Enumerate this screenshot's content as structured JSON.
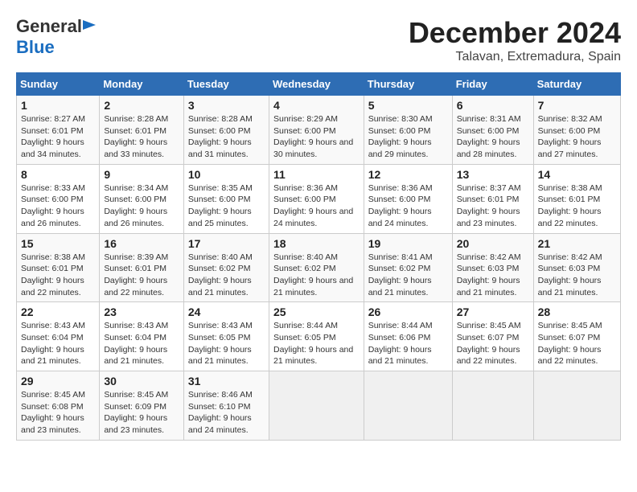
{
  "header": {
    "logo_general": "General",
    "logo_blue": "Blue",
    "month_title": "December 2024",
    "subtitle": "Talavan, Extremadura, Spain"
  },
  "calendar": {
    "days_of_week": [
      "Sunday",
      "Monday",
      "Tuesday",
      "Wednesday",
      "Thursday",
      "Friday",
      "Saturday"
    ],
    "weeks": [
      [
        null,
        null,
        null,
        null,
        null,
        null,
        null
      ]
    ],
    "cells": [
      {
        "day": null,
        "sunrise": null,
        "sunset": null,
        "daylight": null
      },
      {
        "day": null,
        "sunrise": null,
        "sunset": null,
        "daylight": null
      },
      {
        "day": null,
        "sunrise": null,
        "sunset": null,
        "daylight": null
      },
      {
        "day": null,
        "sunrise": null,
        "sunset": null,
        "daylight": null
      },
      {
        "day": null,
        "sunrise": null,
        "sunset": null,
        "daylight": null
      },
      {
        "day": null,
        "sunrise": null,
        "sunset": null,
        "daylight": null
      },
      {
        "day": null,
        "sunrise": null,
        "sunset": null,
        "daylight": null
      }
    ],
    "rows": [
      {
        "cells": [
          {
            "day": "1",
            "sunrise": "Sunrise: 8:27 AM",
            "sunset": "Sunset: 6:01 PM",
            "daylight": "Daylight: 9 hours and 34 minutes."
          },
          {
            "day": "2",
            "sunrise": "Sunrise: 8:28 AM",
            "sunset": "Sunset: 6:01 PM",
            "daylight": "Daylight: 9 hours and 33 minutes."
          },
          {
            "day": "3",
            "sunrise": "Sunrise: 8:28 AM",
            "sunset": "Sunset: 6:00 PM",
            "daylight": "Daylight: 9 hours and 31 minutes."
          },
          {
            "day": "4",
            "sunrise": "Sunrise: 8:29 AM",
            "sunset": "Sunset: 6:00 PM",
            "daylight": "Daylight: 9 hours and 30 minutes."
          },
          {
            "day": "5",
            "sunrise": "Sunrise: 8:30 AM",
            "sunset": "Sunset: 6:00 PM",
            "daylight": "Daylight: 9 hours and 29 minutes."
          },
          {
            "day": "6",
            "sunrise": "Sunrise: 8:31 AM",
            "sunset": "Sunset: 6:00 PM",
            "daylight": "Daylight: 9 hours and 28 minutes."
          },
          {
            "day": "7",
            "sunrise": "Sunrise: 8:32 AM",
            "sunset": "Sunset: 6:00 PM",
            "daylight": "Daylight: 9 hours and 27 minutes."
          }
        ]
      },
      {
        "cells": [
          {
            "day": "8",
            "sunrise": "Sunrise: 8:33 AM",
            "sunset": "Sunset: 6:00 PM",
            "daylight": "Daylight: 9 hours and 26 minutes."
          },
          {
            "day": "9",
            "sunrise": "Sunrise: 8:34 AM",
            "sunset": "Sunset: 6:00 PM",
            "daylight": "Daylight: 9 hours and 26 minutes."
          },
          {
            "day": "10",
            "sunrise": "Sunrise: 8:35 AM",
            "sunset": "Sunset: 6:00 PM",
            "daylight": "Daylight: 9 hours and 25 minutes."
          },
          {
            "day": "11",
            "sunrise": "Sunrise: 8:36 AM",
            "sunset": "Sunset: 6:00 PM",
            "daylight": "Daylight: 9 hours and 24 minutes."
          },
          {
            "day": "12",
            "sunrise": "Sunrise: 8:36 AM",
            "sunset": "Sunset: 6:00 PM",
            "daylight": "Daylight: 9 hours and 24 minutes."
          },
          {
            "day": "13",
            "sunrise": "Sunrise: 8:37 AM",
            "sunset": "Sunset: 6:01 PM",
            "daylight": "Daylight: 9 hours and 23 minutes."
          },
          {
            "day": "14",
            "sunrise": "Sunrise: 8:38 AM",
            "sunset": "Sunset: 6:01 PM",
            "daylight": "Daylight: 9 hours and 22 minutes."
          }
        ]
      },
      {
        "cells": [
          {
            "day": "15",
            "sunrise": "Sunrise: 8:38 AM",
            "sunset": "Sunset: 6:01 PM",
            "daylight": "Daylight: 9 hours and 22 minutes."
          },
          {
            "day": "16",
            "sunrise": "Sunrise: 8:39 AM",
            "sunset": "Sunset: 6:01 PM",
            "daylight": "Daylight: 9 hours and 22 minutes."
          },
          {
            "day": "17",
            "sunrise": "Sunrise: 8:40 AM",
            "sunset": "Sunset: 6:02 PM",
            "daylight": "Daylight: 9 hours and 21 minutes."
          },
          {
            "day": "18",
            "sunrise": "Sunrise: 8:40 AM",
            "sunset": "Sunset: 6:02 PM",
            "daylight": "Daylight: 9 hours and 21 minutes."
          },
          {
            "day": "19",
            "sunrise": "Sunrise: 8:41 AM",
            "sunset": "Sunset: 6:02 PM",
            "daylight": "Daylight: 9 hours and 21 minutes."
          },
          {
            "day": "20",
            "sunrise": "Sunrise: 8:42 AM",
            "sunset": "Sunset: 6:03 PM",
            "daylight": "Daylight: 9 hours and 21 minutes."
          },
          {
            "day": "21",
            "sunrise": "Sunrise: 8:42 AM",
            "sunset": "Sunset: 6:03 PM",
            "daylight": "Daylight: 9 hours and 21 minutes."
          }
        ]
      },
      {
        "cells": [
          {
            "day": "22",
            "sunrise": "Sunrise: 8:43 AM",
            "sunset": "Sunset: 6:04 PM",
            "daylight": "Daylight: 9 hours and 21 minutes."
          },
          {
            "day": "23",
            "sunrise": "Sunrise: 8:43 AM",
            "sunset": "Sunset: 6:04 PM",
            "daylight": "Daylight: 9 hours and 21 minutes."
          },
          {
            "day": "24",
            "sunrise": "Sunrise: 8:43 AM",
            "sunset": "Sunset: 6:05 PM",
            "daylight": "Daylight: 9 hours and 21 minutes."
          },
          {
            "day": "25",
            "sunrise": "Sunrise: 8:44 AM",
            "sunset": "Sunset: 6:05 PM",
            "daylight": "Daylight: 9 hours and 21 minutes."
          },
          {
            "day": "26",
            "sunrise": "Sunrise: 8:44 AM",
            "sunset": "Sunset: 6:06 PM",
            "daylight": "Daylight: 9 hours and 21 minutes."
          },
          {
            "day": "27",
            "sunrise": "Sunrise: 8:45 AM",
            "sunset": "Sunset: 6:07 PM",
            "daylight": "Daylight: 9 hours and 22 minutes."
          },
          {
            "day": "28",
            "sunrise": "Sunrise: 8:45 AM",
            "sunset": "Sunset: 6:07 PM",
            "daylight": "Daylight: 9 hours and 22 minutes."
          }
        ]
      },
      {
        "cells": [
          {
            "day": "29",
            "sunrise": "Sunrise: 8:45 AM",
            "sunset": "Sunset: 6:08 PM",
            "daylight": "Daylight: 9 hours and 23 minutes."
          },
          {
            "day": "30",
            "sunrise": "Sunrise: 8:45 AM",
            "sunset": "Sunset: 6:09 PM",
            "daylight": "Daylight: 9 hours and 23 minutes."
          },
          {
            "day": "31",
            "sunrise": "Sunrise: 8:46 AM",
            "sunset": "Sunset: 6:10 PM",
            "daylight": "Daylight: 9 hours and 24 minutes."
          },
          null,
          null,
          null,
          null
        ]
      }
    ]
  }
}
